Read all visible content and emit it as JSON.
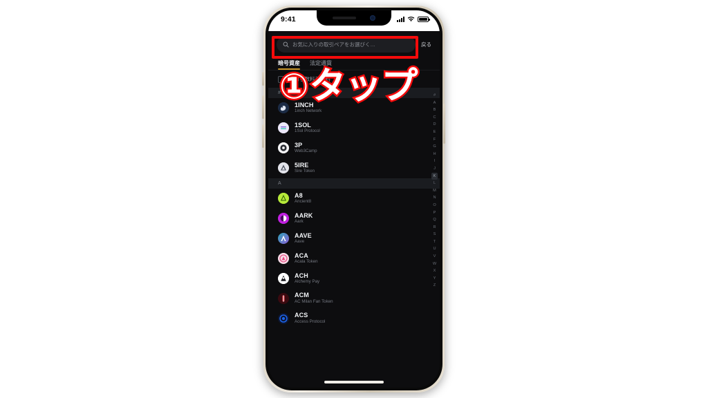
{
  "device": {
    "status_bar": {
      "time": "9:41",
      "signal_icon": "cellular-signal-icon",
      "wifi_icon": "wifi-icon",
      "battery_icon": "battery-icon"
    },
    "home_indicator": "home-indicator"
  },
  "search": {
    "icon": "search-icon",
    "placeholder": "お気に入りの取引ペアをお選びく…",
    "value": "",
    "back_label": "戻る"
  },
  "tabs": [
    {
      "label": "暗号資産",
      "active": true
    },
    {
      "label": "法定通貨",
      "active": false
    }
  ],
  "filter": {
    "checked": false,
    "label": "ゼロ手数料手数料"
  },
  "sections": [
    {
      "header": "#",
      "items": [
        {
          "symbol": "1INCH",
          "name": "1inch Network",
          "icon": "coin-icon-1inch",
          "color": "#2b3a57"
        },
        {
          "symbol": "1SOL",
          "name": "1Sol Protocol",
          "icon": "coin-icon-1sol",
          "color": "#e8e4f5"
        },
        {
          "symbol": "3P",
          "name": "Web3Camp",
          "icon": "coin-icon-3p",
          "color": "#f2f2f2"
        },
        {
          "symbol": "5IRE",
          "name": "Sire Token",
          "icon": "coin-icon-5ire",
          "color": "#dcdde3"
        }
      ]
    },
    {
      "header": "A",
      "items": [
        {
          "symbol": "A8",
          "name": "Ancient8",
          "icon": "coin-icon-a8",
          "color": "#b6e93a"
        },
        {
          "symbol": "AARK",
          "name": "Aark",
          "icon": "coin-icon-aark",
          "color": "#c020e0"
        },
        {
          "symbol": "AAVE",
          "name": "Aave",
          "icon": "coin-icon-aave",
          "color": "#2ea4b8"
        },
        {
          "symbol": "ACA",
          "name": "Acala Token",
          "icon": "coin-icon-aca",
          "color": "#f27ba5"
        },
        {
          "symbol": "ACH",
          "name": "Alchemy Pay",
          "icon": "coin-icon-ach",
          "color": "#ffffff"
        },
        {
          "symbol": "ACM",
          "name": "AC Milan Fan Token",
          "icon": "coin-icon-acm",
          "color": "#5c1118"
        },
        {
          "symbol": "ACS",
          "name": "Access Protocol",
          "icon": "coin-icon-acs",
          "color": "#1b63e8"
        }
      ]
    }
  ],
  "alphabet_index": {
    "entries": [
      "#",
      "A",
      "B",
      "C",
      "D",
      "E",
      "F",
      "G",
      "H",
      "I",
      "J",
      "K",
      "L",
      "M",
      "N",
      "O",
      "P",
      "Q",
      "R",
      "S",
      "T",
      "U",
      "V",
      "W",
      "X",
      "Y",
      "Z"
    ],
    "highlighted": "K"
  },
  "annotations": {
    "highlight_color": "#f40b0b",
    "step_number": "①",
    "step_text": "タップ"
  }
}
